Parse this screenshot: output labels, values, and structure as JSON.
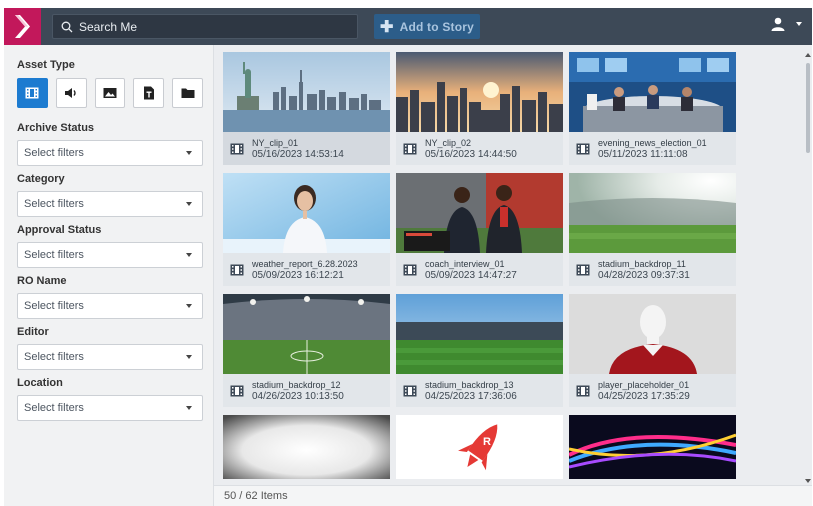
{
  "header": {
    "search_placeholder": "Search Me",
    "add_to_story_label": "Add to Story",
    "logo_icon": "brand-chevron-icon",
    "user_icon": "user-icon",
    "accent": "#c2185b"
  },
  "sidebar": {
    "asset_type_label": "Asset Type",
    "asset_types": [
      {
        "icon": "film-icon",
        "active": true
      },
      {
        "icon": "audio-icon",
        "active": false
      },
      {
        "icon": "image-icon",
        "active": false
      },
      {
        "icon": "text-document-icon",
        "active": false
      },
      {
        "icon": "folder-icon",
        "active": false
      }
    ],
    "filters": [
      {
        "label": "Archive Status",
        "value": "Select filters"
      },
      {
        "label": "Category",
        "value": "Select filters"
      },
      {
        "label": "Approval Status",
        "value": "Select filters"
      },
      {
        "label": "RO Name",
        "value": "Select filters"
      },
      {
        "label": "Editor",
        "value": "Select filters"
      },
      {
        "label": "Location",
        "value": "Select filters"
      }
    ]
  },
  "assets": [
    {
      "name": "NY_clip_01",
      "date": "05/16/2023 14:53:14",
      "selected": true
    },
    {
      "name": "NY_clip_02",
      "date": "05/16/2023 14:44:50"
    },
    {
      "name": "evening_news_election_01",
      "date": "05/11/2023 11:11:08"
    },
    {
      "name": "weather_report_6.28.2023",
      "date": "05/09/2023 16:12:21"
    },
    {
      "name": "coach_interview_01",
      "date": "05/09/2023 14:47:27"
    },
    {
      "name": "stadium_backdrop_11",
      "date": "04/28/2023 09:37:31"
    },
    {
      "name": "stadium_backdrop_12",
      "date": "04/26/2023 10:13:50"
    },
    {
      "name": "stadium_backdrop_13",
      "date": "04/25/2023 17:36:06"
    },
    {
      "name": "player_placeholder_01",
      "date": "04/25/2023 17:35:29"
    }
  ],
  "status": {
    "item_count": "50 / 62 Items"
  }
}
